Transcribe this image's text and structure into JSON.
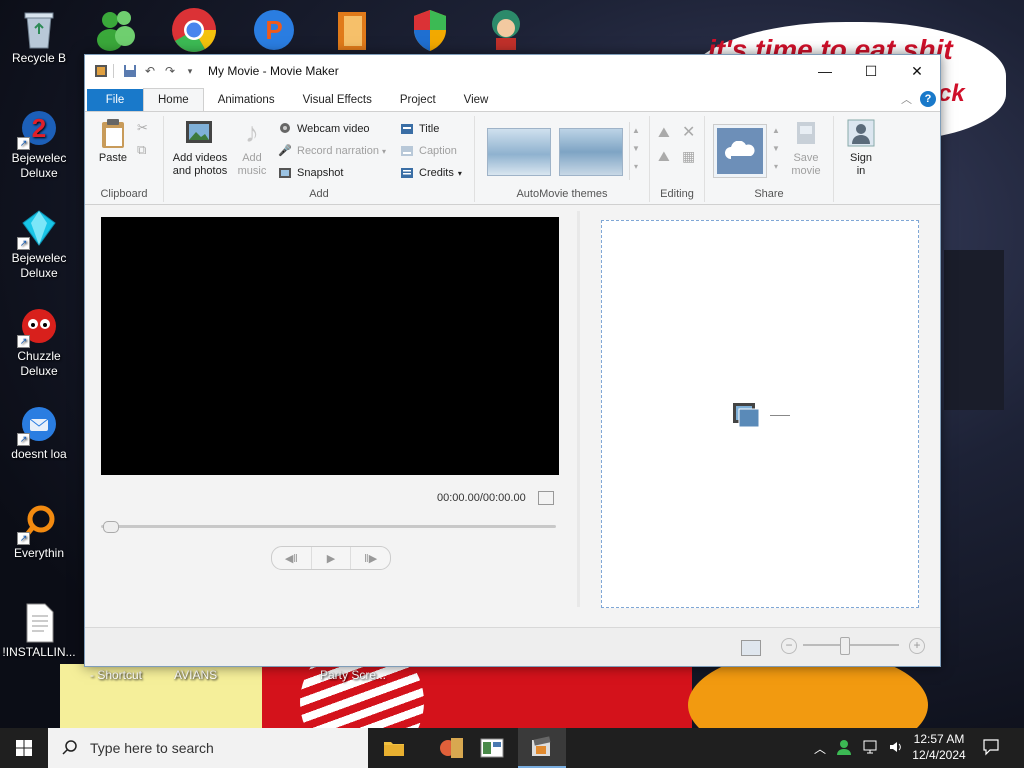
{
  "desktop": {
    "icons": [
      {
        "label": "Recycle B",
        "icon": "recycle-bin-icon"
      },
      {
        "label": "Bejewelec\nDeluxe",
        "icon": "bejeweled-twist-icon"
      },
      {
        "label": "Bejewelec\nDeluxe",
        "icon": "bejeweled-gem-icon"
      },
      {
        "label": "Chuzzle\nDeluxe",
        "icon": "chuzzle-icon"
      },
      {
        "label": "doesnt loa",
        "icon": "thunderbird-icon"
      },
      {
        "label": "Everythin",
        "icon": "everything-search-icon"
      },
      {
        "label": "!INSTALLIN...",
        "icon": "text-file-icon"
      }
    ],
    "bottom_labels": [
      "- Shortcut",
      "AVIANS",
      "Party Scre..."
    ],
    "wallpaper_text": [
      "it's time to eat shit",
      "ck"
    ]
  },
  "window": {
    "title": "My Movie - Movie Maker",
    "tabs": [
      "File",
      "Home",
      "Animations",
      "Visual Effects",
      "Project",
      "View"
    ],
    "active_tab": "Home",
    "ribbon": {
      "clipboard": {
        "paste": "Paste",
        "label": "Clipboard"
      },
      "add": {
        "add_videos": "Add videos\nand photos",
        "add_music": "Add\nmusic",
        "webcam": "Webcam video",
        "narration": "Record narration",
        "snapshot": "Snapshot",
        "title": "Title",
        "caption": "Caption",
        "credits": "Credits",
        "label": "Add"
      },
      "themes": {
        "label": "AutoMovie themes"
      },
      "editing": {
        "label": "Editing"
      },
      "share": {
        "save_movie": "Save\nmovie",
        "sign_in": "Sign\nin",
        "label": "Share"
      }
    },
    "player": {
      "timecode": "00:00.00/00:00.00"
    }
  },
  "taskbar": {
    "search_placeholder": "Type here to search",
    "time": "12:57 AM",
    "date": "12/4/2024"
  },
  "colors": {
    "accent": "#1979ca",
    "taskbar": "#1f1f1f"
  }
}
